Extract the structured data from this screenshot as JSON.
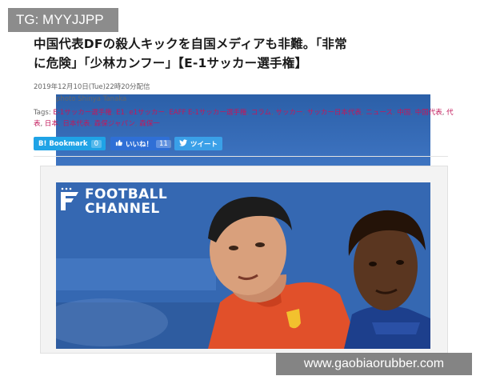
{
  "overlay": {
    "tg_label": "TG: MYYJJPP",
    "watermark": "www.gaobiaorubber.com"
  },
  "article": {
    "headline_line1": "中国代表DFの殺人キックを自国メディアも非難。「非常",
    "headline_line2": "に危険」「少林カンフー」【E-1サッカー選手権】",
    "date": "2019年12月10日(Tue)22時20分配信",
    "photo_credit": "photo Shinya Tanaka",
    "tags_label": "Tags:",
    "tags": [
      "E-1サッカー選手権",
      "E1",
      "e1サッカー",
      "EAFF E-1サッカー選手権",
      "コラム",
      "サッカー",
      "サッカー日本代表",
      "ニュース",
      "中国",
      "中国代表",
      "代表",
      "日本",
      "日本代表",
      "森保ジャパン",
      "森保一"
    ]
  },
  "share": {
    "hatena_label": "B! Bookmark",
    "hatena_count": "0",
    "like_label": "いいね！",
    "like_count": "11",
    "tweet_label": "ツイート"
  },
  "image": {
    "logo_line1": "FOOTBALL",
    "logo_line2": "CHANNEL"
  },
  "colors": {
    "tag_link": "#c2185b",
    "hatena": "#1fa3e6",
    "like": "#2f6fd6",
    "tweet": "#3aa0e8",
    "china_jersey": "#e1502a"
  }
}
